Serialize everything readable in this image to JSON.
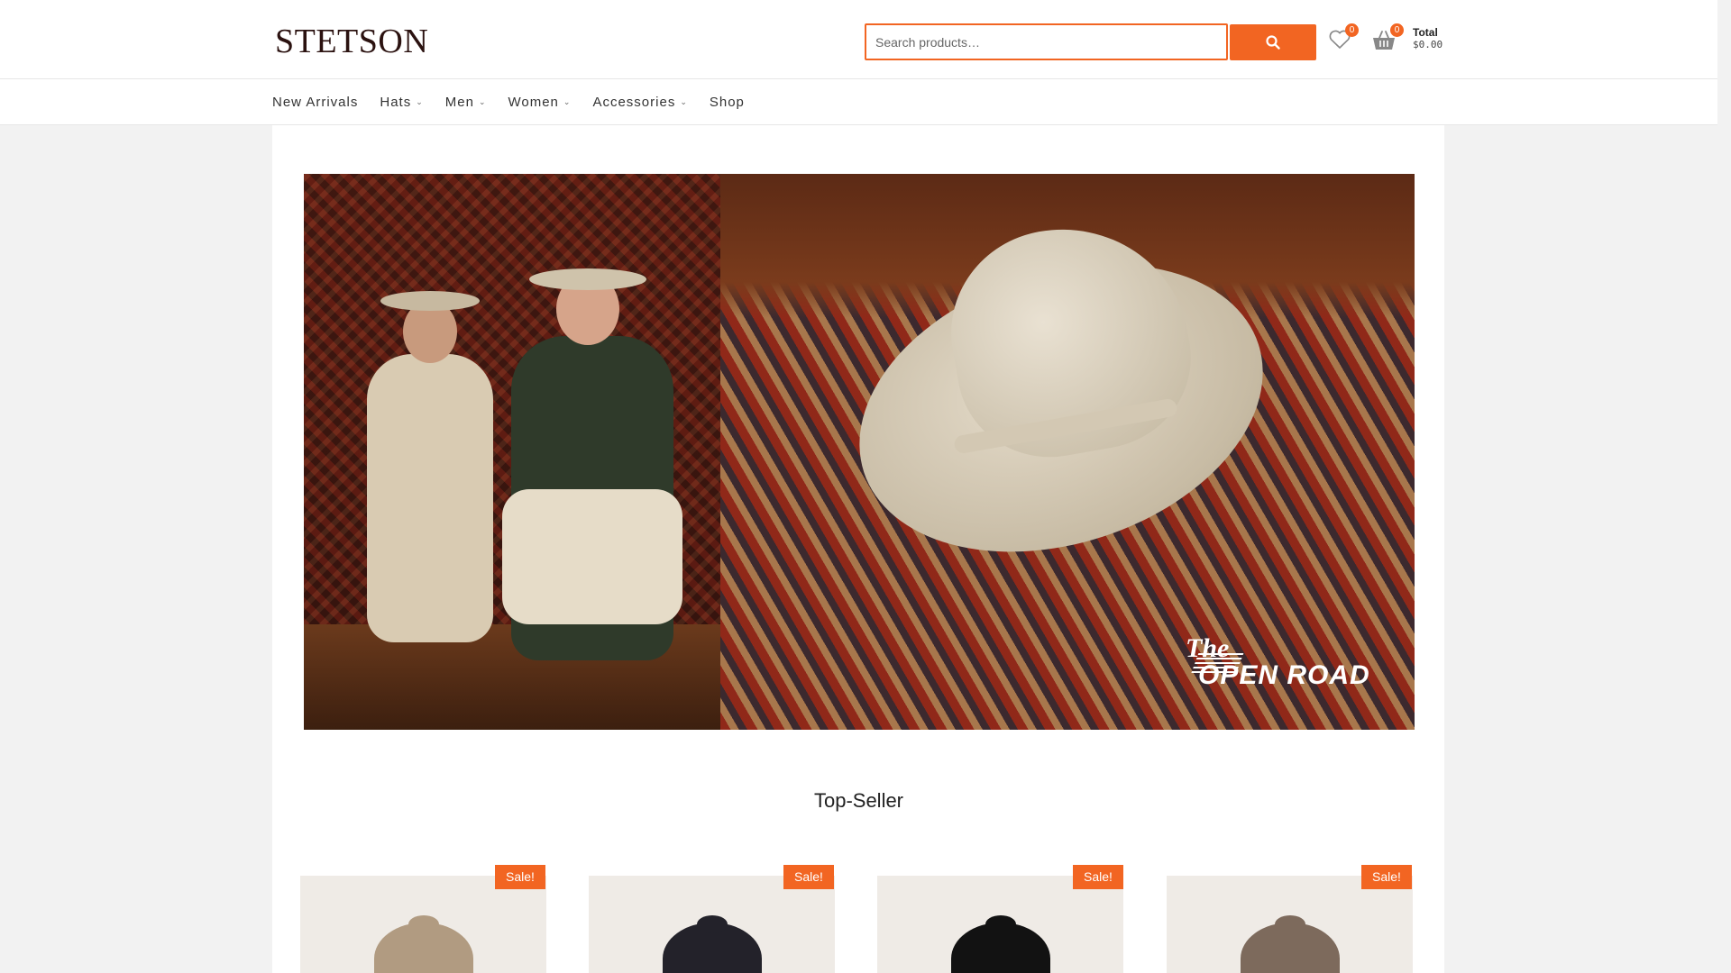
{
  "header": {
    "logo": "STETSON",
    "search_placeholder": "Search products…",
    "wishlist_count": "0",
    "cart_count": "0",
    "total_label": "Total",
    "total_amount": "$0.00"
  },
  "nav": {
    "items": [
      {
        "label": "New Arrivals",
        "has_dropdown": false
      },
      {
        "label": "Hats",
        "has_dropdown": true
      },
      {
        "label": "Men",
        "has_dropdown": true
      },
      {
        "label": "Women",
        "has_dropdown": true
      },
      {
        "label": "Accessories",
        "has_dropdown": true
      },
      {
        "label": "Shop",
        "has_dropdown": false
      }
    ]
  },
  "hero": {
    "logo_the": "The",
    "logo_text": "OPEN ROAD"
  },
  "main": {
    "section_title": "Top-Seller",
    "products": [
      {
        "badge": "Sale!",
        "hat_color": "#b19b81"
      },
      {
        "badge": "Sale!",
        "hat_color": "#23222a"
      },
      {
        "badge": "Sale!",
        "hat_color": "#121212"
      },
      {
        "badge": "Sale!",
        "hat_color": "#7d6a5c"
      }
    ]
  },
  "colors": {
    "accent": "#f26522",
    "brand": "#2b1210"
  },
  "icons": {
    "search": "search-icon",
    "wishlist": "heart-icon",
    "cart": "basket-icon",
    "dropdown": "chevron-down-icon"
  }
}
